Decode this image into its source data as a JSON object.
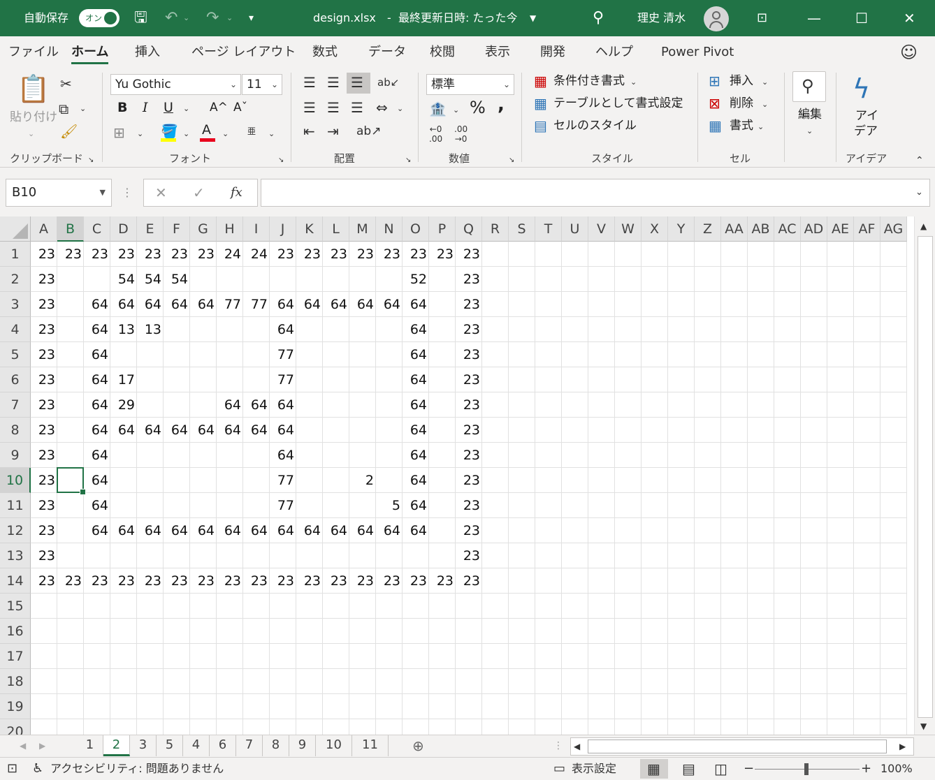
{
  "titlebar": {
    "autosave_label": "自動保存",
    "autosave_state": "オン",
    "filename": "design.xlsx",
    "separator": "-",
    "last_modified": "最終更新日時: たった今",
    "user_name": "理史 清水",
    "accent": "#217346"
  },
  "tabs": [
    "ファイル",
    "ホーム",
    "挿入",
    "ページ レイアウト",
    "数式",
    "データ",
    "校閲",
    "表示",
    "開発",
    "ヘルプ",
    "Power Pivot"
  ],
  "active_tab": "ホーム",
  "ribbon": {
    "clipboard": {
      "paste": "貼り付け",
      "label": "クリップボード"
    },
    "font": {
      "name": "Yu Gothic",
      "size": "11",
      "bold": "B",
      "italic": "I",
      "underline": "U",
      "grow": "A^",
      "shrink": "Aˇ",
      "color_letter": "A",
      "label": "フォント"
    },
    "alignment": {
      "label": "配置"
    },
    "number": {
      "format": "標準",
      "percent": "%",
      "comma": ",",
      "label": "数値"
    },
    "styles": {
      "conditional": "条件付き書式",
      "table": "テーブルとして書式設定",
      "cell_styles": "セルのスタイル",
      "label": "スタイル"
    },
    "cells": {
      "insert": "挿入",
      "delete": "削除",
      "format": "書式",
      "label": "セル"
    },
    "editing": {
      "label": "編集"
    },
    "ideas": {
      "line1": "アイ",
      "line2": "デア",
      "label": "アイデア"
    }
  },
  "formula_bar": {
    "name_box": "B10",
    "cancel": "✕",
    "enter": "✓",
    "fx": "fx",
    "value": ""
  },
  "columns": [
    "A",
    "B",
    "C",
    "D",
    "E",
    "F",
    "G",
    "H",
    "I",
    "J",
    "K",
    "L",
    "M",
    "N",
    "O",
    "P",
    "Q",
    "R",
    "S",
    "T",
    "U",
    "V",
    "W",
    "X",
    "Y",
    "Z",
    "AA",
    "AB",
    "AC",
    "AD",
    "AE",
    "AF",
    "AG"
  ],
  "rows": [
    "1",
    "2",
    "3",
    "4",
    "5",
    "6",
    "7",
    "8",
    "9",
    "10",
    "11",
    "12",
    "13",
    "14",
    "15",
    "16",
    "17",
    "18",
    "19",
    "20"
  ],
  "selected": {
    "col": "B",
    "row": "10"
  },
  "cells": [
    [
      "23",
      "23",
      "23",
      "23",
      "23",
      "23",
      "23",
      "24",
      "24",
      "23",
      "23",
      "23",
      "23",
      "23",
      "23",
      "23",
      "23"
    ],
    [
      "23",
      "",
      "",
      "54",
      "54",
      "54",
      "",
      "",
      "",
      "",
      "",
      "",
      "",
      "",
      "52",
      "",
      "23"
    ],
    [
      "23",
      "",
      "64",
      "64",
      "64",
      "64",
      "64",
      "77",
      "77",
      "64",
      "64",
      "64",
      "64",
      "64",
      "64",
      "",
      "23"
    ],
    [
      "23",
      "",
      "64",
      "13",
      "13",
      "",
      "",
      "",
      "",
      "64",
      "",
      "",
      "",
      "",
      "64",
      "",
      "23"
    ],
    [
      "23",
      "",
      "64",
      "",
      "",
      "",
      "",
      "",
      "",
      "77",
      "",
      "",
      "",
      "",
      "64",
      "",
      "23"
    ],
    [
      "23",
      "",
      "64",
      "17",
      "",
      "",
      "",
      "",
      "",
      "77",
      "",
      "",
      "",
      "",
      "64",
      "",
      "23"
    ],
    [
      "23",
      "",
      "64",
      "29",
      "",
      "",
      "",
      "64",
      "64",
      "64",
      "",
      "",
      "",
      "",
      "64",
      "",
      "23"
    ],
    [
      "23",
      "",
      "64",
      "64",
      "64",
      "64",
      "64",
      "64",
      "64",
      "64",
      "",
      "",
      "",
      "",
      "64",
      "",
      "23"
    ],
    [
      "23",
      "",
      "64",
      "",
      "",
      "",
      "",
      "",
      "",
      "64",
      "",
      "",
      "",
      "",
      "64",
      "",
      "23"
    ],
    [
      "23",
      "",
      "64",
      "",
      "",
      "",
      "",
      "",
      "",
      "77",
      "",
      "",
      "2",
      "",
      "64",
      "",
      "23"
    ],
    [
      "23",
      "",
      "64",
      "",
      "",
      "",
      "",
      "",
      "",
      "77",
      "",
      "",
      "",
      "5",
      "64",
      "",
      "23"
    ],
    [
      "23",
      "",
      "64",
      "64",
      "64",
      "64",
      "64",
      "64",
      "64",
      "64",
      "64",
      "64",
      "64",
      "64",
      "64",
      "",
      "23"
    ],
    [
      "23",
      "",
      "",
      "",
      "",
      "",
      "",
      "",
      "",
      "",
      "",
      "",
      "",
      "",
      "",
      "",
      "23"
    ],
    [
      "23",
      "23",
      "23",
      "23",
      "23",
      "23",
      "23",
      "23",
      "23",
      "23",
      "23",
      "23",
      "23",
      "23",
      "23",
      "23",
      "23"
    ]
  ],
  "sheets": [
    "1",
    "2",
    "3",
    "5",
    "4",
    "6",
    "7",
    "8",
    "9",
    "10",
    "11"
  ],
  "active_sheet": "2",
  "status": {
    "accessibility": "アクセシビリティ: 問題ありません",
    "display_settings": "表示設定",
    "zoom": "100%",
    "zoom_level": 1.0
  }
}
